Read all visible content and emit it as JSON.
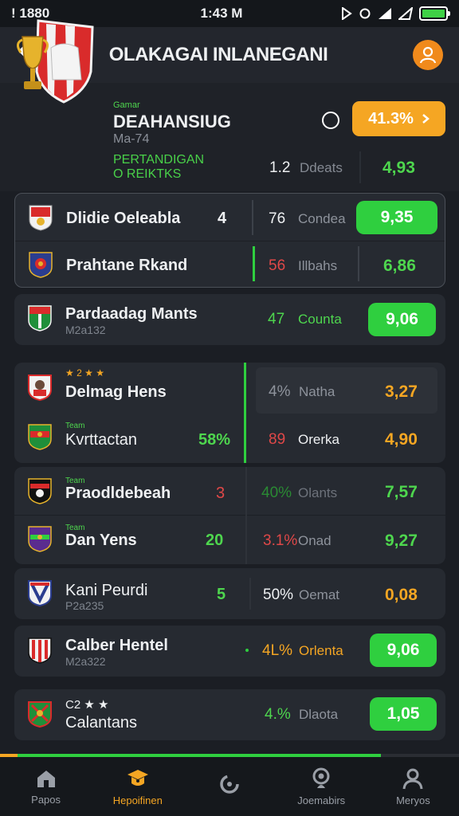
{
  "status": {
    "left": "! 1880",
    "time": "1:43 M",
    "icons": [
      "play-icon",
      "sync-icon",
      "signal-icon",
      "wifi-icon",
      "battery-icon"
    ]
  },
  "header": {
    "title": "OLAKAGAI INLANEGANI"
  },
  "featured": {
    "small_label": "Gamar",
    "title": "DEAHANSIUG",
    "subtitle": "Ma-74",
    "green_line1": "PERTANDIGAN",
    "green_line2": "O REIKTKS",
    "odds_button": "41.3%",
    "number": "1.2",
    "label": "Ddeats",
    "odd": "4,93"
  },
  "cards": [
    {
      "rows": [
        {
          "name": "Dlidie Oeleabla",
          "score": "4",
          "pct": "76",
          "market": "Condea",
          "odd": "9,35",
          "odd_style": "button"
        },
        {
          "name": "Prahtane Rkand",
          "score": "",
          "pct": "56",
          "market": "Illbahs",
          "odd": "6,86",
          "odd_style": "green"
        }
      ]
    },
    {
      "rows": [
        {
          "name": "Pardaadag Mants",
          "sub": "M2a132",
          "pct": "47",
          "market": "Counta",
          "odd": "9,06",
          "odd_style": "button"
        }
      ]
    },
    {
      "rows": [
        {
          "top": "★ 2 ★ ★",
          "name": "Delmag Hens",
          "pct": "4%",
          "market": "Natha",
          "odd": "3,27",
          "odd_style": "orange"
        },
        {
          "tiny": "Team",
          "name": "Kvrttactan",
          "score": "58%",
          "pct": "89",
          "market": "Orerka",
          "odd": "4,90",
          "odd_style": "orange"
        }
      ]
    },
    {
      "rows": [
        {
          "tiny": "Team",
          "name": "Praodldebeah",
          "score": "3",
          "pct": "40%",
          "market": "Olants",
          "odd": "7,57",
          "odd_style": "green"
        },
        {
          "tiny": "Team",
          "name": "Dan Yens",
          "score": "20",
          "pct": "3.1%",
          "market": "Onad",
          "odd": "9,27",
          "odd_style": "green"
        }
      ]
    },
    {
      "rows": [
        {
          "name": "Kani Peurdi",
          "sub": "P2a235",
          "score": "5",
          "pct": "50%",
          "market": "Oemat",
          "odd": "0,08",
          "odd_style": "orange"
        }
      ]
    },
    {
      "rows": [
        {
          "name": "Calber Hentel",
          "sub": "M2a322",
          "pct": "4L%",
          "market": "Orlenta",
          "odd": "9,06",
          "odd_style": "button"
        }
      ]
    },
    {
      "rows": [
        {
          "top": "C2 ★ ★",
          "name": "Calantans",
          "pct": "4.%",
          "market": "Dlaota",
          "odd": "1,05",
          "odd_style": "button"
        }
      ]
    }
  ],
  "progress": {
    "value": 0.83
  },
  "nav": [
    {
      "label": "Papos",
      "icon": "home-icon",
      "active": false
    },
    {
      "label": "Hepoifinen",
      "icon": "graduation-cap-icon",
      "active": true
    },
    {
      "label": "",
      "icon": "refresh-icon",
      "active": false
    },
    {
      "label": "Joemabirs",
      "icon": "podcast-icon",
      "active": false
    },
    {
      "label": "Meryos",
      "icon": "profile-icon",
      "active": false
    }
  ],
  "colors": {
    "accent_orange": "#f5a623",
    "accent_green": "#2fcf3f",
    "red": "#e04848",
    "background": "#1b1e24"
  }
}
